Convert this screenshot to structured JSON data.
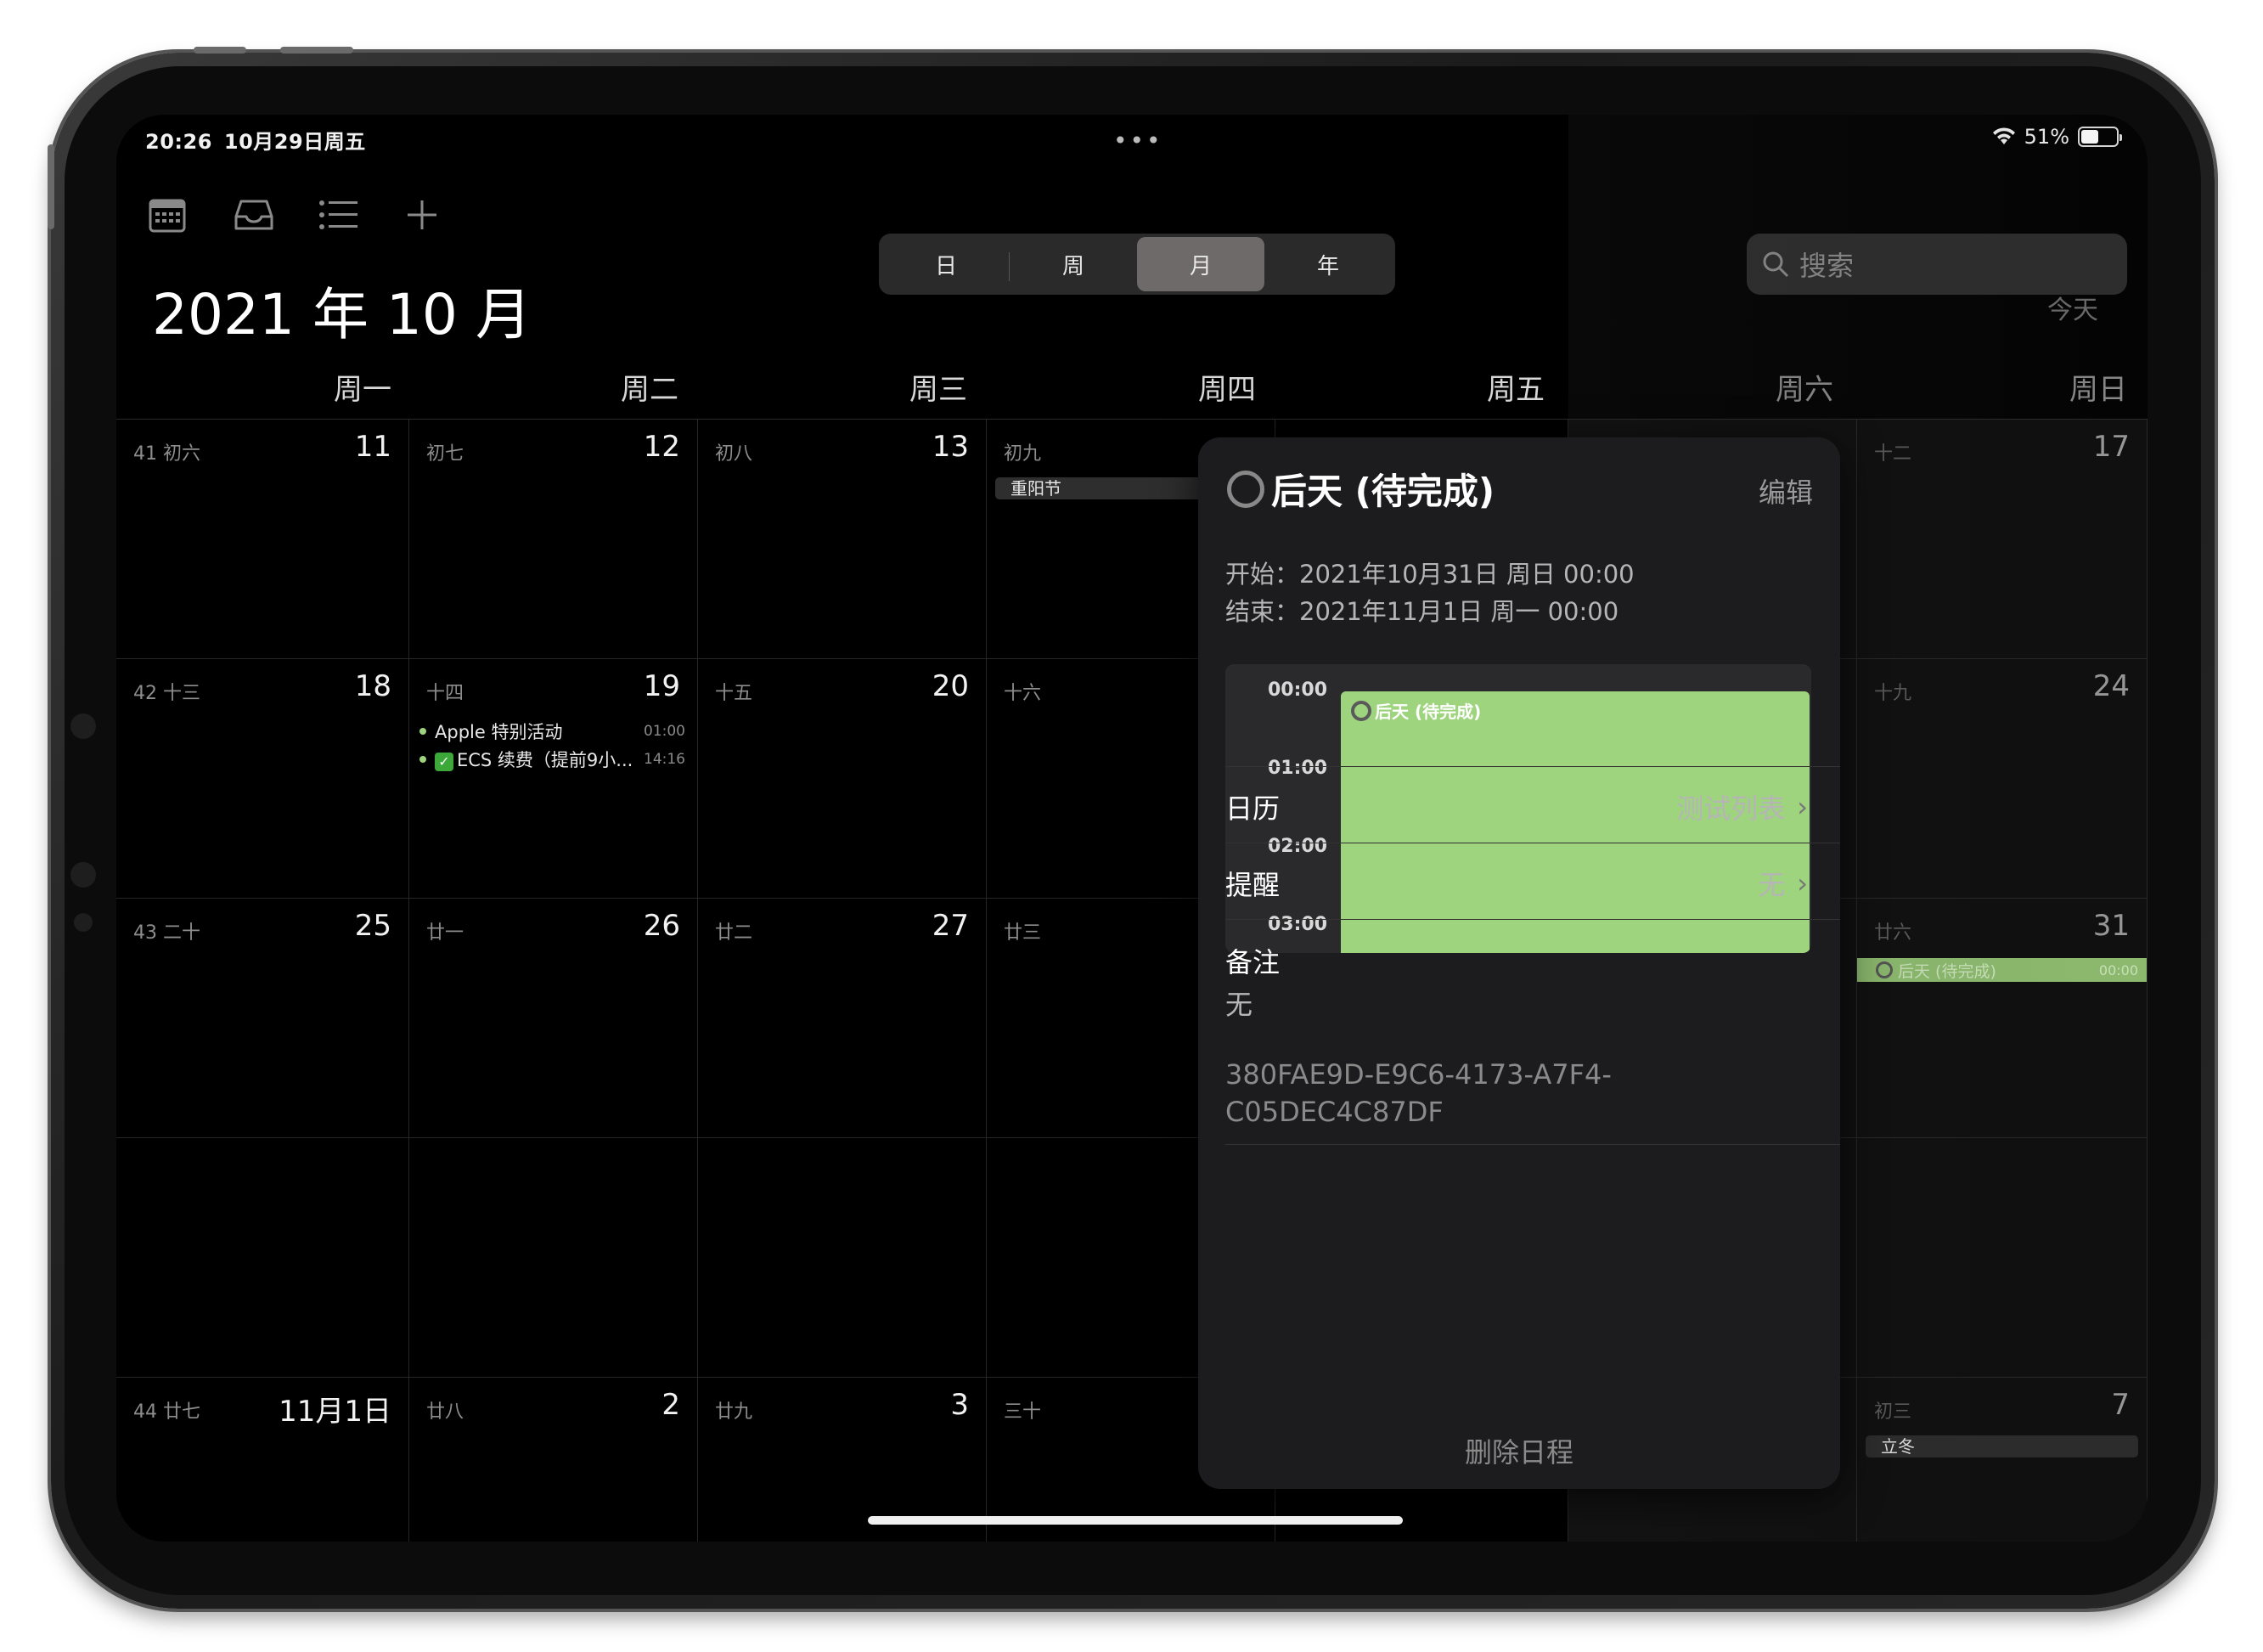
{
  "status": {
    "time": "20:26",
    "date": "10月29日周五",
    "battery": "51%",
    "battery_level": 0.51,
    "multitask": "•••"
  },
  "toolbar": {
    "icons": [
      "calendar-icon",
      "inbox-icon",
      "list-icon",
      "plus-icon"
    ],
    "segments": [
      "日",
      "周",
      "月",
      "年"
    ],
    "selected_segment": "月",
    "search_placeholder": "搜索"
  },
  "header": {
    "month_title": "2021 年 10 月",
    "today": "今天"
  },
  "weekdays": [
    "周一",
    "周二",
    "周三",
    "周四",
    "周五",
    "周六",
    "周日"
  ],
  "weeks": [
    {
      "days": [
        {
          "lunar": "41 初六",
          "num": "11"
        },
        {
          "lunar": "初七",
          "num": "12"
        },
        {
          "lunar": "初八",
          "num": "13"
        },
        {
          "lunar": "初九",
          "num": "",
          "holiday": "重阳节"
        },
        {
          "lunar": "",
          "num": ""
        },
        {
          "lunar": "",
          "num": ""
        },
        {
          "lunar": "十二",
          "num": "17"
        }
      ]
    },
    {
      "days": [
        {
          "lunar": "42 十三",
          "num": "18"
        },
        {
          "lunar": "十四",
          "num": "19"
        },
        {
          "lunar": "十五",
          "num": "20"
        },
        {
          "lunar": "十六",
          "num": ""
        },
        {
          "lunar": "",
          "num": ""
        },
        {
          "lunar": "",
          "num": ""
        },
        {
          "lunar": "十九",
          "num": "24"
        }
      ]
    },
    {
      "days": [
        {
          "lunar": "43 二十",
          "num": "25"
        },
        {
          "lunar": "廿一",
          "num": "26"
        },
        {
          "lunar": "廿二",
          "num": "27"
        },
        {
          "lunar": "廿三",
          "num": ""
        },
        {
          "lunar": "",
          "num": ""
        },
        {
          "lunar": "",
          "num": ""
        },
        {
          "lunar": "廿六",
          "num": "31"
        }
      ]
    },
    {
      "days": [
        {
          "lunar": "",
          "num": ""
        },
        {
          "lunar": "",
          "num": ""
        },
        {
          "lunar": "",
          "num": ""
        },
        {
          "lunar": "",
          "num": ""
        },
        {
          "lunar": "",
          "num": ""
        },
        {
          "lunar": "",
          "num": ""
        },
        {
          "lunar": "",
          "num": ""
        }
      ]
    },
    {
      "days": [
        {
          "lunar": "44 廿七",
          "num": "11月1日"
        },
        {
          "lunar": "廿八",
          "num": "2"
        },
        {
          "lunar": "廿九",
          "num": "3"
        },
        {
          "lunar": "三十",
          "num": ""
        },
        {
          "lunar": "",
          "num": ""
        },
        {
          "lunar": "",
          "num": ""
        },
        {
          "lunar": "初三",
          "num": "7",
          "holiday": "立冬"
        }
      ]
    }
  ],
  "events_19": [
    {
      "title": "Apple 特别活动",
      "time": "01:00"
    },
    {
      "title": "ECS 续费（提前9小...",
      "time": "14:16"
    }
  ],
  "bar_event": {
    "title": "后天 (待完成)",
    "time": "00:00"
  },
  "popover": {
    "title": "后天 (待完成)",
    "edit": "编辑",
    "start": "开始：2021年10月31日 周日 00:00",
    "end": "结束：2021年11月1日 周一 00:00",
    "hours": [
      "00:00",
      "01:00",
      "02:00",
      "03:00"
    ],
    "mini_event": "后天 (待完成)",
    "calendar_label": "日历",
    "calendar_value": "测试列表",
    "alert_label": "提醒",
    "alert_value": "无",
    "notes_label": "备注",
    "notes_value": "无",
    "uuid": "380FAE9D-E9C6-4173-A7F4-C05DEC4C87DF",
    "delete": "删除日程"
  },
  "colors": {
    "event_green": "#9fd47f",
    "background": "#000000",
    "popover": "#1c1c1e"
  }
}
